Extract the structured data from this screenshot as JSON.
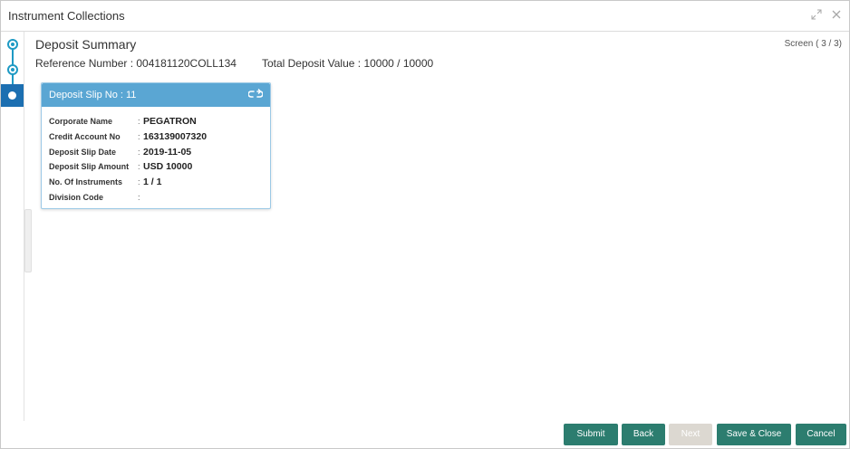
{
  "window": {
    "title": "Instrument Collections",
    "controls": [
      {
        "name": "minimize-icon",
        "glyph": "↗↙"
      },
      {
        "name": "close-icon",
        "glyph": "✕"
      }
    ]
  },
  "stepper": {
    "steps": [
      {
        "state": "done"
      },
      {
        "state": "done"
      },
      {
        "state": "active"
      }
    ],
    "accent_color": "#1e9ac4",
    "active_color": "#1c6fb1"
  },
  "main": {
    "title": "Deposit Summary",
    "screen_indicator": "Screen ( 3 / 3)",
    "reference": "Reference Number : 004181120COLL134",
    "total_deposit": "Total Deposit Value : 10000 / 10000"
  },
  "deposit_card": {
    "header": "Deposit Slip No : 11",
    "header_icon": "link-icon",
    "header_color": "#5aa6d3",
    "fields": [
      {
        "label": "Corporate Name",
        "sep": ":",
        "value": "PEGATRON"
      },
      {
        "label": "Credit Account No",
        "sep": ":",
        "value": "163139007320"
      },
      {
        "label": "Deposit Slip Date",
        "sep": ":",
        "value": "2019-11-05"
      },
      {
        "label": "Deposit Slip Amount",
        "sep": ":",
        "value": "USD 10000"
      },
      {
        "label": "No. Of Instruments",
        "sep": ":",
        "value": "1 / 1"
      },
      {
        "label": "Division Code",
        "sep": ":",
        "value": ""
      }
    ]
  },
  "footer": {
    "submit": "Submit",
    "back": "Back",
    "next": "Next",
    "save_close": "Save & Close",
    "cancel": "Cancel",
    "button_color": "#2c7d6f",
    "disabled_color": "#dcd8d1"
  }
}
